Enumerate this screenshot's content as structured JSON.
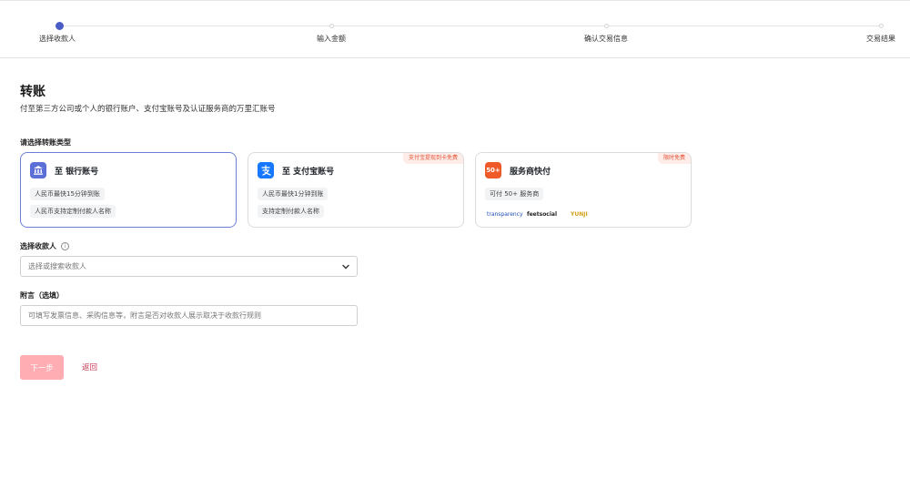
{
  "stepper": {
    "steps": [
      {
        "label": "选择收款人",
        "active": true
      },
      {
        "label": "输入金额",
        "active": false
      },
      {
        "label": "确认交易信息",
        "active": false
      },
      {
        "label": "交易结果",
        "active": false
      }
    ]
  },
  "page": {
    "title": "转账",
    "subtitle": "付至第三方公司或个人的银行账户、支付宝账号及认证服务商的万里汇账号"
  },
  "transfer_type": {
    "label": "请选择转账类型",
    "options": [
      {
        "title": "至 银行账号",
        "icon": "bank-icon",
        "selected": true,
        "tags": [
          "人民币最快15分钟到账",
          "人民币支持定制付款人名称"
        ]
      },
      {
        "title": "至 支付宝账号",
        "icon": "alipay-icon",
        "badge": "支付宝提现到卡免费",
        "tags": [
          "人民币最快1分钟到账",
          "支持定制付款人名称"
        ]
      },
      {
        "title": "服务商快付",
        "icon_text": "50+",
        "badge": "限时免费",
        "tags": [
          "可付 50+ 服务商"
        ],
        "partner_logos": [
          "transparency",
          "feetsocial",
          "YUNJI"
        ]
      }
    ]
  },
  "payee": {
    "label": "选择收款人",
    "placeholder": "选择或搜索收款人"
  },
  "remark": {
    "label": "附言（选填）",
    "placeholder": "可填写发票信息、采购信息等，附言是否对收款人展示取决于收款行规则"
  },
  "actions": {
    "next_label": "下一步",
    "back_label": "返回"
  },
  "colors": {
    "accent": "#4a5dc7",
    "next_button": "#ffadb3",
    "back_link": "#c93b54",
    "badge_text": "#e5553a"
  }
}
